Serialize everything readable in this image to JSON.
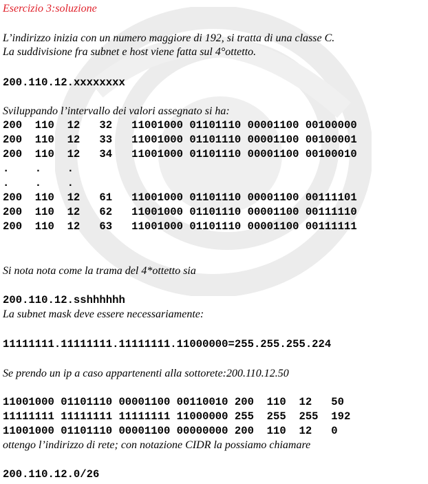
{
  "title": "Esercizio 3:soluzione",
  "intro": [
    "L’indirizzo inizia con un numero maggiore di 192, si tratta di una classe C.",
    "La suddivisione fra subnet e host viene fatta sul 4°ottetto."
  ],
  "address_prefix": "200.110.12.",
  "address_mask": "xxxxxxxx",
  "range_intro": "Sviluppando l’intervallo dei valori assegnato si ha:",
  "range_rows": [
    "200  110  12   32   11001000 01101110 00001100 00100000",
    "200  110  12   33   11001000 01101110 00001100 00100001",
    "200  110  12   34   11001000 01101110 00001100 00100010",
    ".    .    .",
    ".    .    .",
    "200  110  12   61   11001000 01101110 00001100 00111101",
    "200  110  12   62   11001000 01101110 00001100 00111110",
    "200  110  12   63   11001000 01101110 00001100 00111111"
  ],
  "pattern_note": "Si nota nota come la trama del 4*ottetto sia",
  "pattern": "200.110.12.sshhhhhh",
  "mask_note": "La subnet mask deve essere necessariamente:",
  "mask_line": "11111111.11111111.11111111.11000000=255.255.255.224",
  "random_ip_note": "Se prendo un ip a caso appartenenti alla sottorete:200.110.12.50",
  "and_rows": [
    "11001000 01101110 00001100 00110010 200  110  12   50",
    "11111111 11111111 11111111 11000000 255  255  255  192",
    "11001000 01101110 00001100 00000000 200  110  12   0"
  ],
  "cidr_note": "ottengo l’indirizzo di rete; con notazione CIDR la possiamo chiamare",
  "cidr": "200.110.12.0/26"
}
